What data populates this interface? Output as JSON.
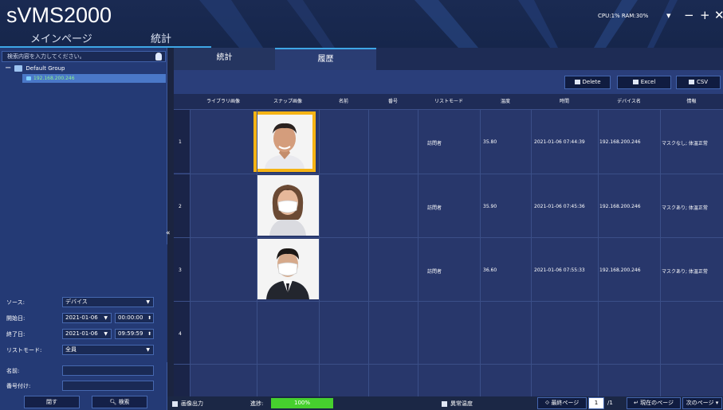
{
  "app": {
    "logo": "sVMS2000",
    "nav": {
      "main_page": "メインページ",
      "statistics": "統計"
    },
    "sysinfo": "CPU:1% RAM:30%",
    "window_controls": {
      "dropdown": "▾",
      "minimize": "−",
      "maximize": "+",
      "close": "✕"
    }
  },
  "sidebar": {
    "search_placeholder": "検索内容を入力してください。",
    "tree": {
      "root_sign": "−",
      "root_label": "Default Group",
      "device": "192.168.200.246"
    },
    "collapse": "«",
    "form": {
      "source": {
        "label": "ソース:",
        "value": "デバイス"
      },
      "start": {
        "label": "開始日:",
        "date": "2021-01-06",
        "time": "00:00:00"
      },
      "end": {
        "label": "終了日:",
        "date": "2021-01-06",
        "time": "09:59:59"
      },
      "list_mode": {
        "label": "リストモード:",
        "value": "全員"
      },
      "name": {
        "label": "名前:",
        "value": ""
      },
      "number": {
        "label": "番号付け:",
        "value": ""
      },
      "close_button": "閉す",
      "search_button": "検索"
    }
  },
  "tabs": {
    "statistics": "統計",
    "history": "履歴"
  },
  "toolbar": {
    "delete": "Delete",
    "excel": "Excel",
    "csv": "CSV"
  },
  "table": {
    "headers": [
      "ライブラリ画像",
      "スナップ画像",
      "名前",
      "番号",
      "リストモード",
      "温度",
      "時間",
      "デバイス名",
      "情報"
    ],
    "rows": [
      {
        "num": "1",
        "mode": "訪問者",
        "temp": "35.80",
        "time": "2021-01-06 07:44:39",
        "device": "192.168.200.246",
        "info": "マスクなし; 体温正常"
      },
      {
        "num": "2",
        "mode": "訪問者",
        "temp": "35.90",
        "time": "2021-01-06 07:45:36",
        "device": "192.168.200.246",
        "info": "マスクあり; 体温正常"
      },
      {
        "num": "3",
        "mode": "訪問者",
        "temp": "36.60",
        "time": "2021-01-06 07:55:33",
        "device": "192.168.200.246",
        "info": "マスクあり; 体温正常"
      },
      {
        "num": "4",
        "mode": "",
        "temp": "",
        "time": "",
        "device": "",
        "info": ""
      }
    ]
  },
  "statusbar": {
    "image_output": "画像出力",
    "progress_label": "進捗:",
    "progress_value": "100%",
    "abnormal_temp": "異常温度",
    "last_page": "最終ページ",
    "page_input": "1",
    "page_total": "/1",
    "current_page": "現在のページ",
    "next_page": "次のページ"
  },
  "colors": {
    "accent": "#3ea6e6",
    "selection": "#f5b314",
    "progress": "#46d02e",
    "device_text": "#8ff38f"
  }
}
